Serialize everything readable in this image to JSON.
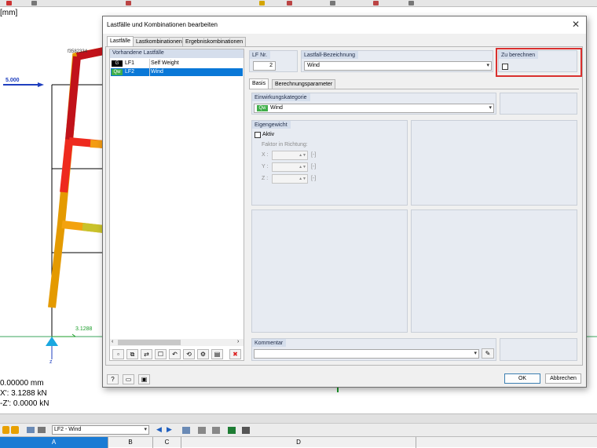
{
  "background": {
    "unit_label": "[mm]",
    "load_label": "5.000",
    "node_label": "f3582334",
    "reaction_value": "3.1288",
    "axis_label": "z",
    "result_lines": [
      "0.00000 mm",
      "X': 3.1288 kN",
      "-Z': 0.0000 kN"
    ]
  },
  "bottom_toolbar": {
    "loadcase_select": "LF2 - Wind",
    "columns": [
      "A",
      "B",
      "C",
      "D"
    ]
  },
  "dialog": {
    "title": "Lastfälle und Kombinationen bearbeiten",
    "tabs": [
      "Lastfälle",
      "Lastkombinationen",
      "Ergebniskombinationen"
    ],
    "existing_header": "Vorhandene Lastfälle",
    "loadcases": [
      {
        "badge": "G",
        "id": "LF1",
        "name": "Self Weight",
        "badge_color": "#000000"
      },
      {
        "badge": "Qw",
        "id": "LF2",
        "name": "Wind",
        "badge_color": "#3fae49"
      }
    ],
    "lf_nr_label": "LF Nr.",
    "lf_nr_value": "2",
    "designation_label": "Lastfall-Bezeichnung",
    "designation_value": "Wind",
    "calculate_label": "Zu berechnen",
    "sub_tabs": [
      "Basis",
      "Berechnungsparameter"
    ],
    "action_category_label": "Einwirkungskategorie",
    "action_category_badge": "Qw",
    "action_category_value": "Wind",
    "selfweight_label": "Eigengewicht",
    "active_label": "Aktiv",
    "factor_label": "Faktor in Richtung:",
    "factors": [
      {
        "axis": "X :",
        "unit": "[-]"
      },
      {
        "axis": "Y :",
        "unit": "[-]"
      },
      {
        "axis": "Z :",
        "unit": "[-]"
      }
    ],
    "comment_label": "Kommentar",
    "ok_label": "OK",
    "cancel_label": "Abbrechen",
    "highlight_color": "#d9302e",
    "selection_color": "#0a78d7"
  }
}
